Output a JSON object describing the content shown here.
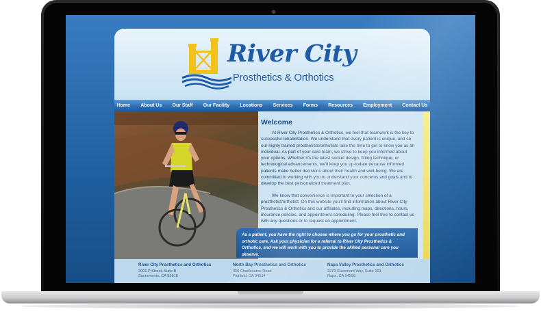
{
  "brand": {
    "name": "River City",
    "tagline": "Prosthetics & Orthotics"
  },
  "nav": {
    "items": [
      "Home",
      "About Us",
      "Our Staff",
      "Our Facility",
      "Locations",
      "Services",
      "Forms",
      "Resources",
      "Employment",
      "Contact Us"
    ]
  },
  "content": {
    "title": "Welcome",
    "paragraphs": [
      "At River City Prosthetics & Orthotics, we feel that teamwork is the key to successful rehabilitation. We understand that every patient is unique, and so our highly trained prosthetists/orthotists take the time to get to know you as an individual. As part of your care team, we strive to keep you informed about your options. Whether it's the latest socket design, fitting technique, or technological advancements, we'll keep you up-todate because informed patients make better decisions about their health and well-being. We are committed to working with you to understand your concerns and goals and to develop the best personalized treatment plan.",
      "We know that convenience is important to your selection of a prosthetist/orthotist. On this website you'll find information about River City Prosthetics & Orthotics and our affiliates, including maps, directions, hours, insurance policies, and appointment scheduling. Please feel free to contact us with any questions or to request an appointment."
    ],
    "banner": "As a patient, you have the right to choose where you go for your prosthetic and orthotic care. Ask your physician for a referral to River City Prosthetics & Orthotics, and we will work with you to provide the skilled personal care you deserve."
  },
  "locations": [
    {
      "name": "River City Prosthetics and Orthotics",
      "address": "3001 P Street, Suite B",
      "city": "Sacramento, CA 95816"
    },
    {
      "name": "North Bay Prosthetics and Orthotics",
      "address": "450 Chadbourne Road",
      "city": "Fairfield, CA 94534"
    },
    {
      "name": "Napa Valley Prosthetics and Orthotics",
      "address": "3273 Claremont Way, Suite 101",
      "city": "Napa, CA 94558"
    }
  ],
  "colors": {
    "brand_blue": "#1f5aa5",
    "logo_yellow": "#f2c21b",
    "nav_blue": "#2d6fb4",
    "accent_strip": "#e7d95a"
  }
}
